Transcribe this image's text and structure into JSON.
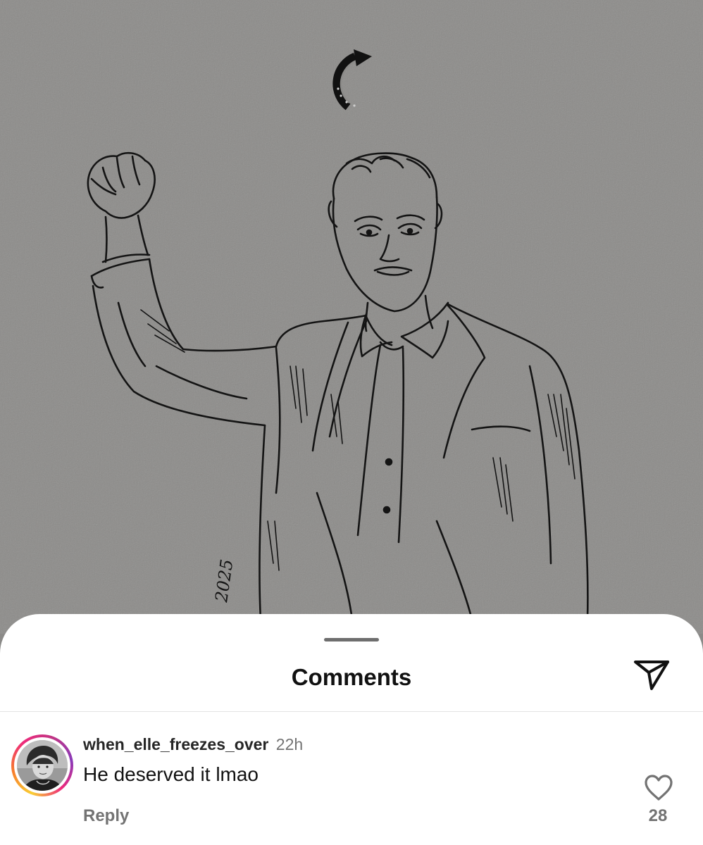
{
  "post": {
    "artwork_signature": "2025"
  },
  "comments_sheet": {
    "title": "Comments",
    "share_icon": "paper-plane-icon",
    "comments": [
      {
        "username": "when_elle_freezes_over",
        "time": "22h",
        "text": "He deserved it lmao",
        "reply_label": "Reply",
        "like_icon": "heart-outline-icon",
        "like_count": "28"
      }
    ]
  },
  "colors": {
    "photo_background": "#8c8b89",
    "sheet_background": "#ffffff",
    "story_ring": [
      "#f9ce34",
      "#ee2a7b",
      "#6228d7"
    ],
    "secondary_text": "#737373"
  }
}
